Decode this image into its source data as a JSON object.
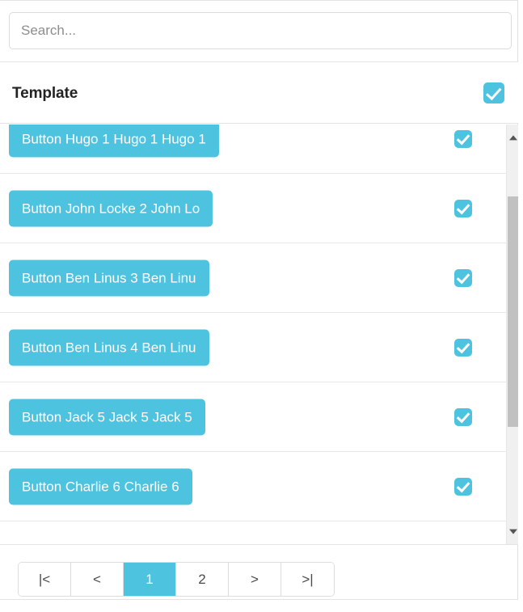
{
  "search": {
    "placeholder": "Search...",
    "value": ""
  },
  "header": {
    "title": "Template",
    "select_all_checked": true,
    "checkbox_icon": "check-icon"
  },
  "list": {
    "rows": [
      {
        "button_label": "Button Hugo 1 Hugo 1 Hugo 1",
        "checked": true
      },
      {
        "button_label": "Button John Locke 2 John Lo",
        "checked": true
      },
      {
        "button_label": "Button Ben Linus 3 Ben Linu",
        "checked": true
      },
      {
        "button_label": "Button Ben Linus 4 Ben Linu",
        "checked": true
      },
      {
        "button_label": "Button Jack 5 Jack 5 Jack 5",
        "checked": true
      },
      {
        "button_label": "Button Charlie 6 Charlie 6",
        "checked": true
      }
    ]
  },
  "scrollbar": {
    "up_arrow_icon": "triangle-up-icon",
    "down_arrow_icon": "triangle-down-icon"
  },
  "pagination": {
    "first_label": "|<",
    "prev_label": "<",
    "next_label": ">",
    "last_label": ">|",
    "pages": [
      "1",
      "2"
    ],
    "current_page": "1"
  },
  "colors": {
    "accent": "#4ec3e0",
    "text": "#232323",
    "border": "#e3e3e3"
  }
}
